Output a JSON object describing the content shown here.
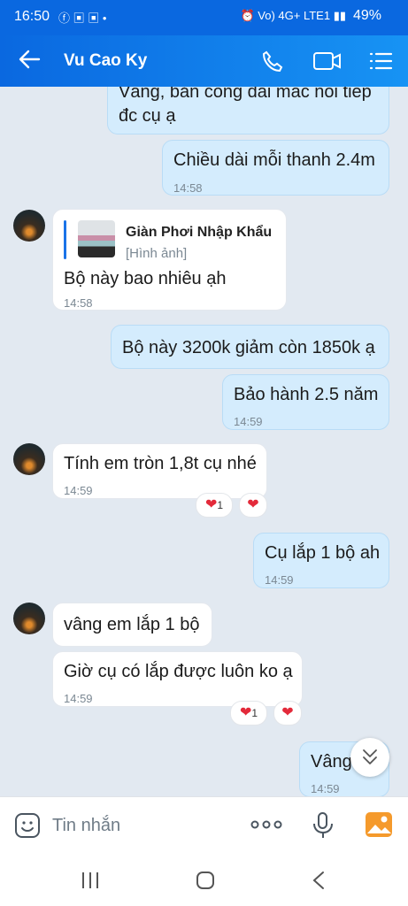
{
  "status": {
    "time": "16:50",
    "network": "Vo) 4G+ LTE1",
    "battery": "49%"
  },
  "header": {
    "title": "Vu Cao Ky",
    "icons": [
      "back-arrow-icon",
      "phone-icon",
      "video-icon",
      "menu-icon"
    ]
  },
  "messages": [
    {
      "from": "me",
      "text_line1": "Vâng, bản công dài mắc nối tiếp",
      "text_line2": "đc cụ ạ"
    },
    {
      "from": "me",
      "text": "Chiều dài mỗi thanh 2.4m",
      "time": "14:58"
    },
    {
      "from": "them",
      "quote_title": "Giàn Phơi Nhập Khẩu",
      "quote_sub": "[Hình ảnh]",
      "text": "Bộ này bao nhiêu ạh",
      "time": "14:58"
    },
    {
      "from": "me",
      "text": "Bộ này 3200k giảm còn 1850k ạ"
    },
    {
      "from": "me",
      "text": "Bảo hành 2.5 năm",
      "time": "14:59"
    },
    {
      "from": "them",
      "text": "Tính em tròn 1,8t cụ nhé",
      "time": "14:59",
      "reaction_count": "1"
    },
    {
      "from": "me",
      "text": "Cụ lắp 1 bộ ah",
      "time": "14:59"
    },
    {
      "from": "them",
      "text": "vâng em lắp 1 bộ"
    },
    {
      "from": "them",
      "text": "Giờ cụ có lắp được luôn ko ạ",
      "time": "14:59",
      "reaction_count": "1"
    },
    {
      "from": "me",
      "text": "Vâng",
      "time": "14:59"
    }
  ],
  "input": {
    "placeholder": "Tin nhắn"
  },
  "colors": {
    "header": "#0a68e0",
    "me_bubble": "#d4ecfd",
    "them_bubble": "#ffffff",
    "background": "#e2e9f1",
    "heart": "#e32a3a"
  }
}
